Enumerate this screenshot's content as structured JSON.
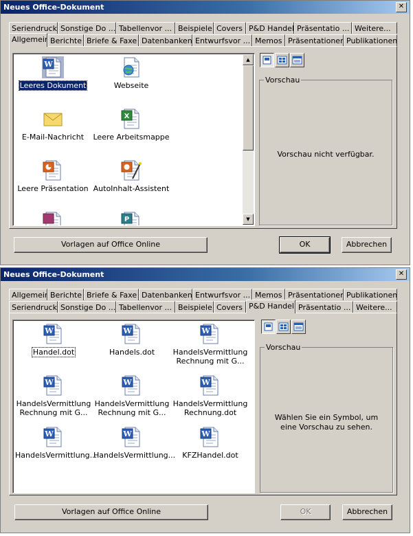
{
  "colors": {
    "titlebar": "#0a246a",
    "face": "#d4d0c8",
    "selection": "#0a246a"
  },
  "dialog1": {
    "title": "Neues Office-Dokument",
    "close": "✕",
    "tabs_back": [
      "Seriendruck",
      "Sonstige Do ...",
      "Tabellenvor ...",
      "Beispiele",
      "Covers",
      "P&D Handel",
      "Präsentatio ...",
      "Weitere..."
    ],
    "tabs_front": [
      "Allgemein",
      "Berichte",
      "Briefe & Faxe",
      "Datenbanken",
      "Entwurfsvor ...",
      "Memos",
      "Präsentationen",
      "Publikationen"
    ],
    "selected_tab": "Allgemein",
    "items": [
      {
        "label": "Leeres Dokument",
        "icon": "word-document-icon"
      },
      {
        "label": "Webseite",
        "icon": "web-page-icon"
      },
      {
        "label": "E-Mail-Nachricht",
        "icon": "envelope-icon"
      },
      {
        "label": "Leere Arbeitsmappe",
        "icon": "excel-workbook-icon"
      },
      {
        "label": "Leere Präsentation",
        "icon": "powerpoint-presentation-icon"
      },
      {
        "label": "AutoInhalt-Assistent",
        "icon": "wizard-icon"
      }
    ],
    "preview_label": "Vorschau",
    "preview_text": "Vorschau nicht verfügbar.",
    "online_button": "Vorlagen auf Office Online",
    "ok": "OK",
    "cancel": "Abbrechen"
  },
  "dialog2": {
    "title": "Neues Office-Dokument",
    "close": "✕",
    "tabs_back": [
      "Allgemein",
      "Berichte",
      "Briefe & Faxe",
      "Datenbanken",
      "Entwurfsvor ...",
      "Memos",
      "Präsentationen",
      "Publikationen"
    ],
    "tabs_front": [
      "Seriendruck",
      "Sonstige Do ...",
      "Tabellenvor ...",
      "Beispiele",
      "Covers",
      "P&D Handel",
      "Präsentatio ...",
      "Weitere..."
    ],
    "selected_tab": "P&D Handel",
    "items": [
      {
        "label": "Handel.dot",
        "icon": "word-template-icon"
      },
      {
        "label": "Handels.dot",
        "icon": "word-template-icon"
      },
      {
        "label": "HandelsVermittlung Rechnung mit G...",
        "icon": "word-template-icon"
      },
      {
        "label": "HandelsVermittlung Rechnung mit G...",
        "icon": "word-template-icon"
      },
      {
        "label": "HandelsVermittlung Rechnung mit G...",
        "icon": "word-template-icon"
      },
      {
        "label": "HandelsVermittlung Rechnung.dot",
        "icon": "word-template-icon"
      },
      {
        "label": "HandelsVermittlung...",
        "icon": "word-template-icon"
      },
      {
        "label": "HandelsVermittlung...",
        "icon": "word-template-icon"
      },
      {
        "label": "KFZHandel.dot",
        "icon": "word-template-icon"
      }
    ],
    "preview_label": "Vorschau",
    "preview_text": "Wählen Sie ein Symbol, um eine Vorschau zu sehen.",
    "online_button": "Vorlagen auf Office Online",
    "ok": "OK",
    "cancel": "Abbrechen"
  }
}
